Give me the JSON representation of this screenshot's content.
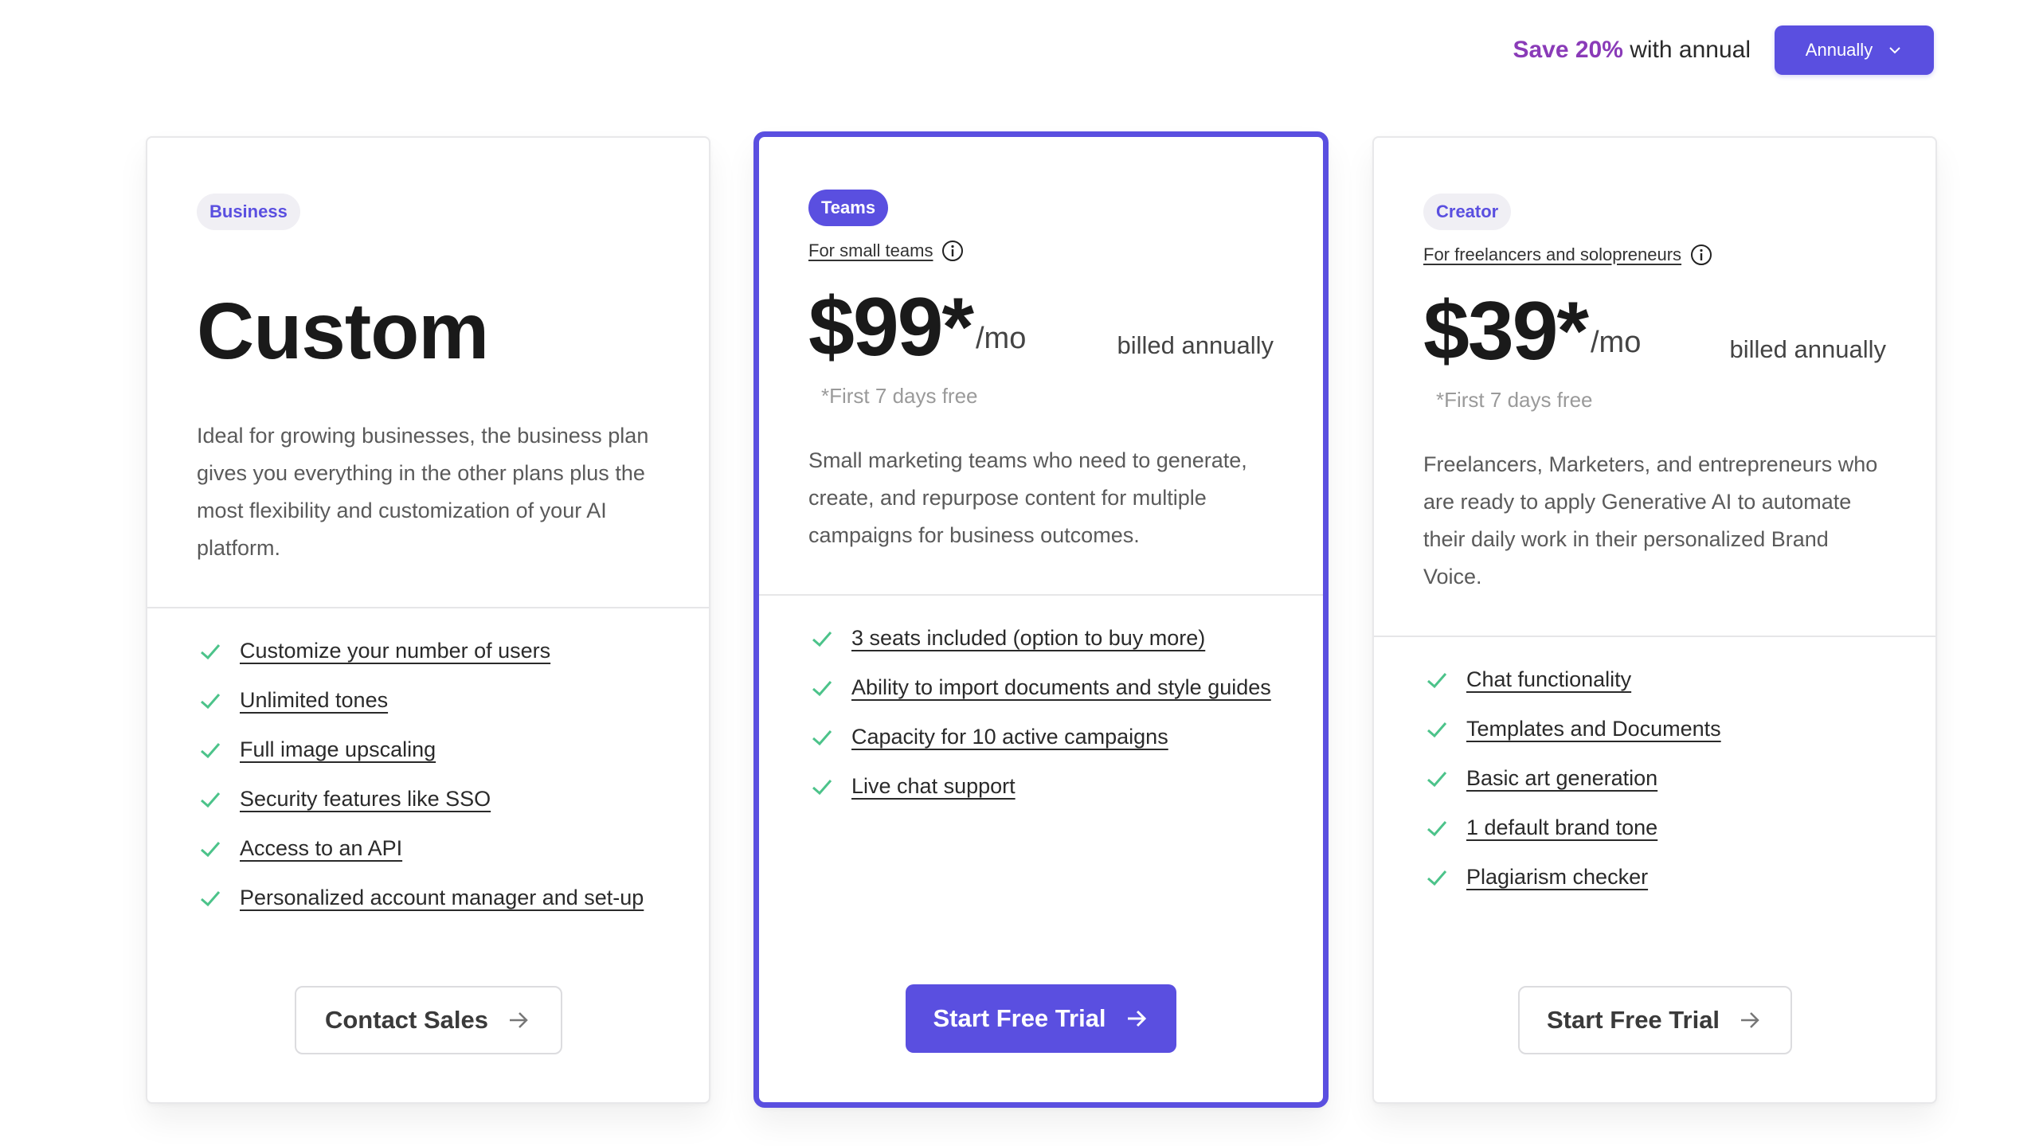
{
  "header": {
    "save_strong": "Save 20%",
    "save_rest": " with annual",
    "period_label": "Annually",
    "accent_color": "#5a4fe0"
  },
  "plans": [
    {
      "badge": "Business",
      "heading": "Custom",
      "description": "Ideal for growing businesses, the business plan gives you everything in the other plans plus the most flexibility and customization of your AI platform.",
      "features": [
        "Customize your number of users",
        "Unlimited tones",
        "Full image upscaling",
        "Security features like SSO",
        "Access to an API",
        "Personalized account manager and set-up"
      ],
      "cta": "Contact Sales"
    },
    {
      "badge": "Teams",
      "subtitle": "For small teams",
      "price": "$99*",
      "per": "/mo",
      "billed": "billed annually",
      "trial_note": "*First 7 days free",
      "description": "Small marketing teams who need to generate, create, and repurpose content for multiple campaigns for business outcomes.",
      "features": [
        "3 seats included (option to buy more)",
        "Ability to import documents and style guides",
        "Capacity for 10 active campaigns",
        "Live chat support"
      ],
      "cta": "Start Free Trial"
    },
    {
      "badge": "Creator",
      "subtitle": "For freelancers and solopreneurs",
      "price": "$39*",
      "per": "/mo",
      "billed": "billed annually",
      "trial_note": "*First 7 days free",
      "description": "Freelancers, Marketers, and entrepreneurs who are ready to apply Generative AI to automate their daily work in their personalized Brand Voice.",
      "features": [
        "Chat functionality",
        "Templates and Documents",
        "Basic art generation",
        "1 default brand tone",
        "Plagiarism checker"
      ],
      "cta": "Start Free Trial"
    }
  ],
  "icons": {
    "check": "check-icon",
    "info": "info-icon",
    "arrow": "arrow-right-icon",
    "chevron": "chevron-down-icon",
    "check_color": "#4cc38a"
  }
}
